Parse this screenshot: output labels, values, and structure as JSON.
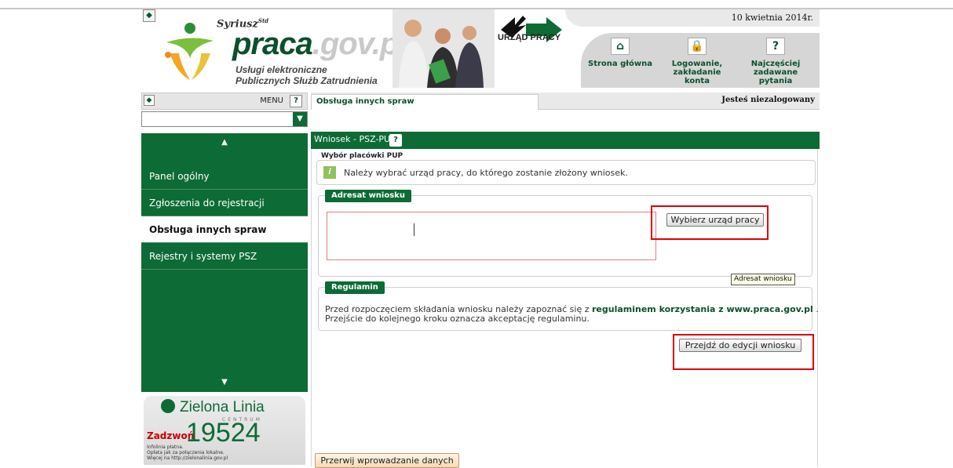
{
  "header": {
    "brand_small": "Syriusz",
    "brand_small_sup": "Std",
    "brand_main": "praca",
    "brand_domain": ".gov.pl",
    "tagline_1": "Usługi elektroniczne",
    "tagline_2": "Publicznych Służb Zatrudnienia",
    "urzad_label": "URZĄD PRACY",
    "date": "10 kwietnia 2014r.",
    "nav": [
      {
        "label_1": "Strona główna",
        "label_2": "",
        "icon": "home-icon"
      },
      {
        "label_1": "Logowanie,",
        "label_2": "zakładanie konta",
        "icon": "lock-icon"
      },
      {
        "label_1": "Najczęściej",
        "label_2": "zadawane pytania",
        "icon": "question-icon"
      }
    ]
  },
  "menu": {
    "label": "MENU",
    "help": "?",
    "select_value": "",
    "items": [
      {
        "label": "Panel ogólny",
        "active": false
      },
      {
        "label": "Zgłoszenia do rejestracji",
        "active": false
      },
      {
        "label": "Obsługa innych spraw",
        "active": true
      },
      {
        "label": "Rejestry i systemy PSZ",
        "active": false
      }
    ]
  },
  "promo": {
    "name": "Zielona Linia",
    "sub": "CENTRUM",
    "call": "Zadzwoń",
    "number": "19524",
    "small_1": "Infolinia płatna.",
    "small_2": "Opłata jak za połączenia lokalne.",
    "small_3": "Więcej na http://zielonalinia.gov.pl"
  },
  "tabs": {
    "active": "Obsługa innych spraw",
    "status": "Jesteś niezalogowany"
  },
  "form": {
    "title": "Wniosek - PSZ-PU",
    "help": "?",
    "subtitle": "Wybór placówki PUP",
    "info": "Należy wybrać urząd pracy, do którego zostanie złożony wniosek.",
    "adresat_legend": "Adresat wniosku",
    "adresat_value": "",
    "choose_button": "Wybierz urząd pracy",
    "tooltip": "Adresat wniosku",
    "regulamin_legend": "Regulamin",
    "reg_text_1": "Przed rozpoczęciem składania wniosku należy zapoznać się z",
    "reg_link": "regulaminem korzystania z www.praca.gov.pl",
    "reg_text_1_end": ".",
    "reg_text_2": "Przejście do kolejnego kroku oznacza akceptację regulaminu.",
    "next_button": "Przejdź do edycji wniosku",
    "cancel_button": "Przerwij wprowadzanie danych"
  }
}
